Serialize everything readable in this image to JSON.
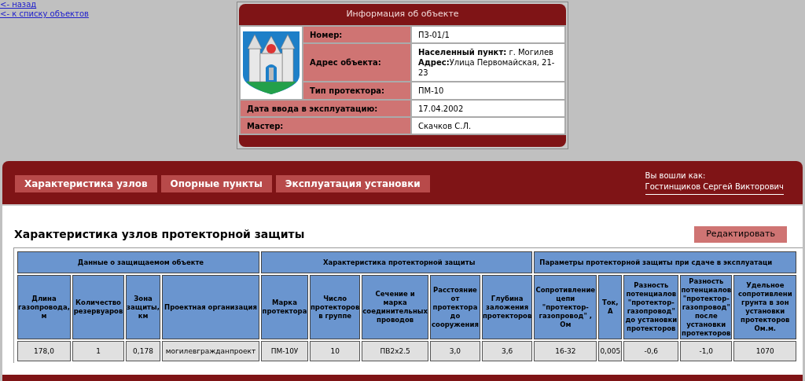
{
  "nav_links": [
    "<- назад",
    "<- к списку объектов"
  ],
  "object_info": {
    "title": "Информация об объекте",
    "rows": [
      {
        "label": "Номер:",
        "lines": [
          "П3-01/1"
        ]
      },
      {
        "label": "Адрес объекта:",
        "lines": [
          "**Населенный пункт:** г. Могилев",
          "**Адрес:**Улица Первомайская, 21-23"
        ]
      },
      {
        "label": "Тип протектора:",
        "lines": [
          "ПМ-10"
        ]
      },
      {
        "label": "Дата ввода в эксплуатацию:",
        "lines": [
          "17.04.2002"
        ]
      },
      {
        "label": "Мастер:",
        "lines": [
          "Скачков С.Л."
        ]
      }
    ]
  },
  "tabs": [
    "Характеристика узлов",
    "Опорные пункты",
    "Эксплуатация установки"
  ],
  "user": {
    "label": "Вы вошли как:",
    "name": "Гостинщиков Сергей Викторович"
  },
  "section": {
    "title": "Характеристика узлов протекторной защиты",
    "edit_button": "Редактировать"
  },
  "table": {
    "groups": [
      {
        "label": "Данные о защищаемом объекте",
        "columns": [
          "Длина газопровода, м",
          "Количество резервуаров",
          "Зона защиты, км",
          "Проектная организация"
        ]
      },
      {
        "label": "Характеристика протекторной защиты",
        "columns": [
          "Марка протектора",
          "Число протекторов в группе",
          "Сечение и марка соединительных проводов",
          "Расстояние от протектора до сооружения",
          "Глубина заложения протекторов"
        ]
      },
      {
        "label": "Параметры протекторной защиты при сдаче в эксплуатаци",
        "columns": [
          "Сопротивление цепи \"протектор-газопровод\" , Ом",
          "Ток, А",
          "Разность потенциалов \"протектор-газопровод\" до установки протекторов",
          "Разность потенциалов \"протектор-газопровод\" после установки протекторов",
          "Удельное сопротивлени грунта в зон установки протекторов Ом.м."
        ]
      }
    ],
    "rows": [
      [
        "178,0",
        "1",
        "0,178",
        "могилевгражданпроект",
        "ПМ-10У",
        "10",
        "ПВ2х2.5",
        "3,0",
        "3,6",
        "16-32",
        "0,005",
        "-0,6",
        "-1,0",
        "1070"
      ]
    ]
  }
}
